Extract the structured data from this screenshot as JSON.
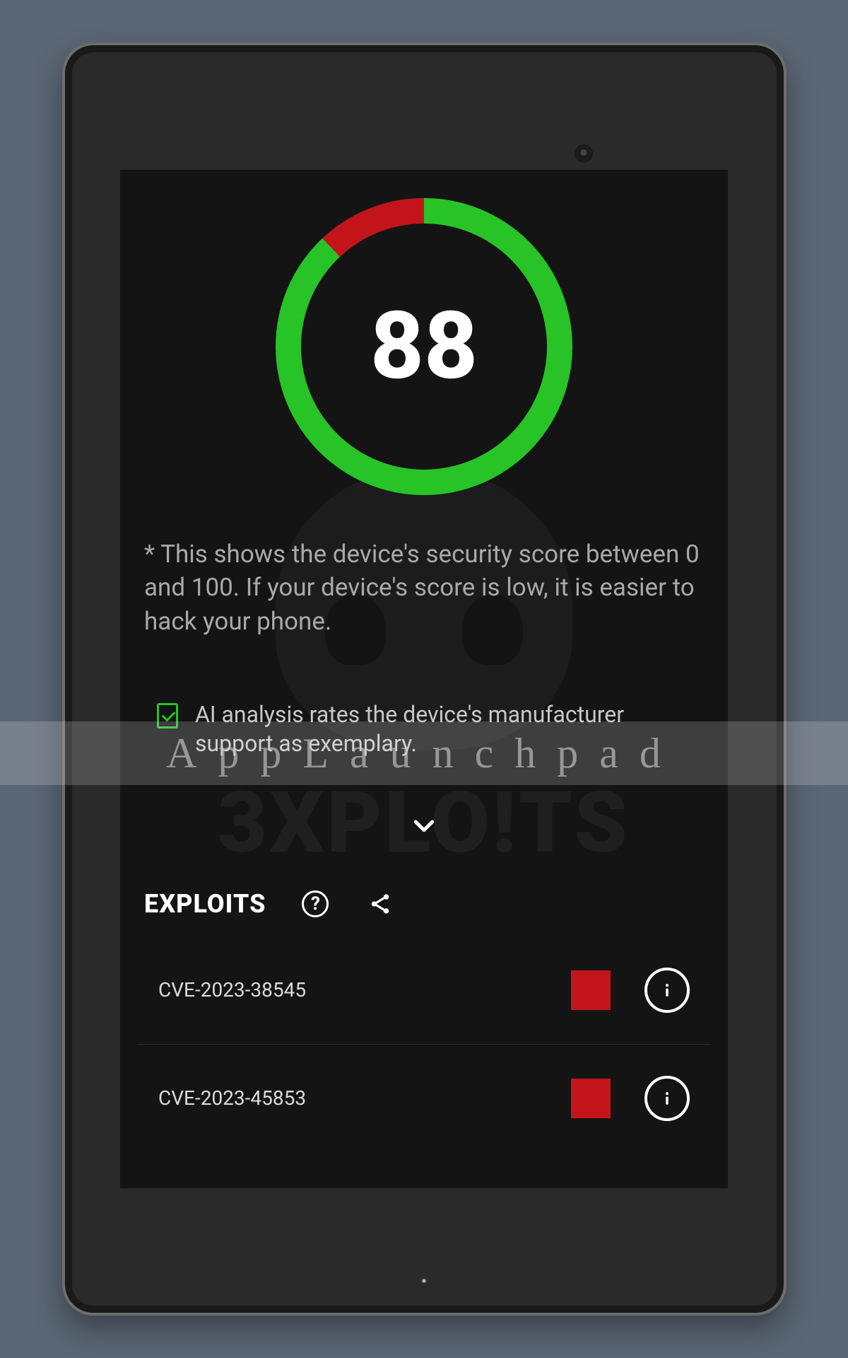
{
  "chart_data": {
    "type": "pie",
    "title": "Security score gauge",
    "value": 88,
    "max": 100,
    "series": [
      {
        "name": "score",
        "values": [
          88
        ],
        "color": "#27c327"
      },
      {
        "name": "remaining",
        "values": [
          12
        ],
        "color": "#c4141b"
      }
    ]
  },
  "colors": {
    "scoreGood": "#27c327",
    "scoreBad": "#c4141b",
    "severityHigh": "#c4141b"
  },
  "score": {
    "value": "88",
    "description": "* This shows the device's security score between 0 and 100. If your device's score is low, it is easier to hack your phone."
  },
  "ai": {
    "message": "AI analysis rates the device's manufacturer support as exemplary."
  },
  "exploits": {
    "title": "EXPLOITS",
    "items": [
      {
        "id": "CVE-2023-38545",
        "severityColor": "#c4141b"
      },
      {
        "id": "CVE-2023-45853",
        "severityColor": "#c4141b"
      }
    ]
  },
  "watermark": {
    "text": "AppLaunchpad"
  },
  "background": {
    "logoText": "3XPLO!TS"
  }
}
